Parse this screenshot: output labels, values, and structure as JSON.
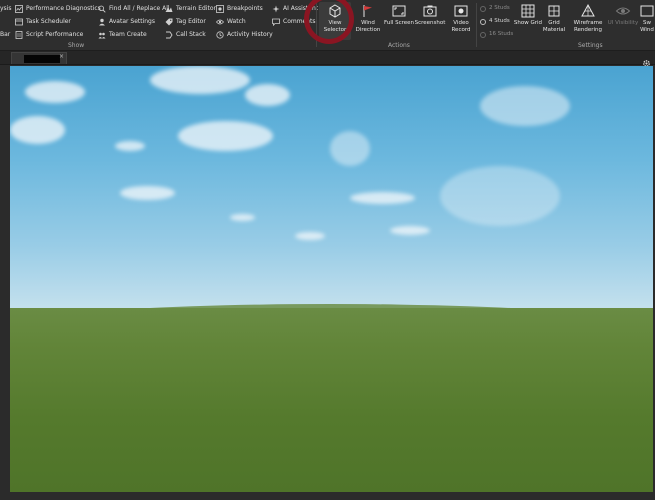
{
  "ribbon": {
    "col0": [
      "ysis",
      "Bar"
    ],
    "show_group": {
      "label": "Show",
      "col1": [
        {
          "label": "Performance Diagnostics",
          "icon": "performance-icon"
        },
        {
          "label": "Task Scheduler",
          "icon": "task-icon"
        },
        {
          "label": "Script Performance",
          "icon": "script-icon"
        }
      ],
      "col2": [
        {
          "label": "Find All / Replace All",
          "icon": "find-icon"
        },
        {
          "label": "Avatar Settings",
          "icon": "avatar-icon"
        },
        {
          "label": "Team Create",
          "icon": "team-icon"
        }
      ],
      "col3": [
        {
          "label": "Terrain Editor",
          "icon": "terrain-icon"
        },
        {
          "label": "Tag Editor",
          "icon": "tag-icon"
        },
        {
          "label": "Call Stack",
          "icon": "callstack-icon"
        }
      ],
      "col4": [
        {
          "label": "Breakpoints",
          "icon": "breakpoint-icon"
        },
        {
          "label": "Watch",
          "icon": "watch-icon"
        },
        {
          "label": "Activity History",
          "icon": "history-icon"
        }
      ],
      "col5": [
        {
          "label": "AI Assistant",
          "icon": "ai-icon"
        },
        {
          "label": "Comments",
          "icon": "comment-icon"
        }
      ]
    },
    "actions_group": {
      "label": "Actions",
      "buttons": [
        {
          "label": "View Selector"
        },
        {
          "label": "Wind Direction"
        },
        {
          "label": "Full Screen"
        },
        {
          "label": "Screenshot"
        },
        {
          "label": "Video Record"
        }
      ]
    },
    "settings_group": {
      "label": "Settings",
      "studs": [
        "2 Studs",
        "4 Studs",
        "16 Studs"
      ],
      "selected_stud": "4 Studs",
      "buttons": [
        {
          "label": "Show Grid"
        },
        {
          "label": "Grid Material"
        },
        {
          "label": "Wireframe Rendering"
        },
        {
          "label": "UI Visibility"
        },
        {
          "label": "Sw Wind"
        }
      ]
    }
  },
  "tab": {
    "close": "×"
  },
  "colors": {
    "annotation": "#8a1522"
  }
}
